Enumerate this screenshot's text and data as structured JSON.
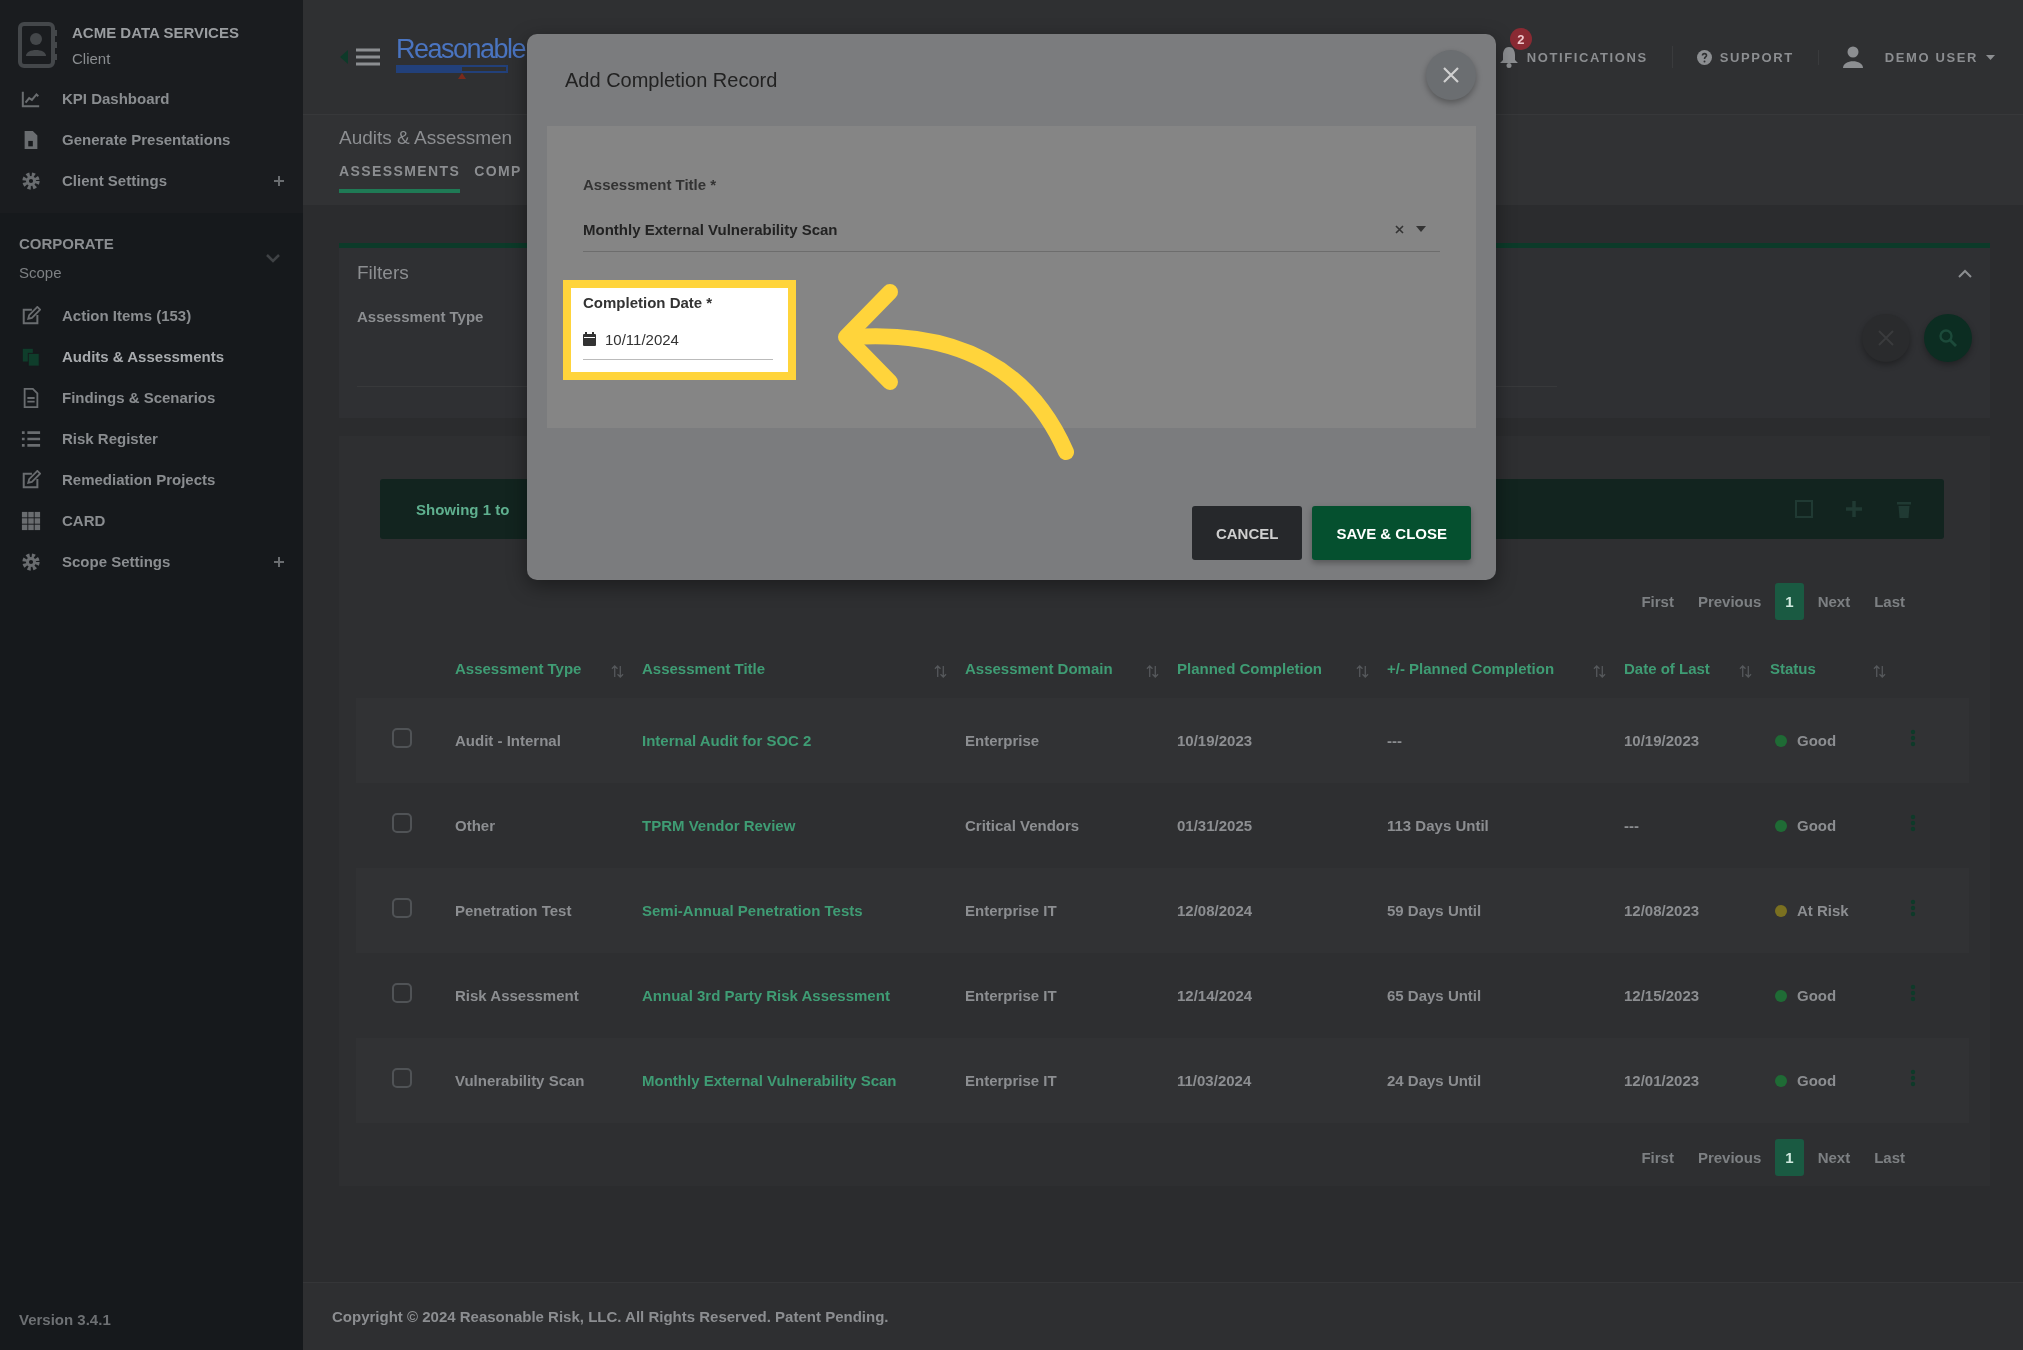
{
  "sidebar": {
    "client": {
      "name": "ACME DATA SERVICES",
      "role": "Client"
    },
    "client_items": [
      {
        "label": "KPI Dashboard",
        "selected": false,
        "expandable": false
      },
      {
        "label": "Generate Presentations",
        "selected": false,
        "expandable": false
      },
      {
        "label": "Client Settings",
        "selected": false,
        "expandable": true
      }
    ],
    "scope": {
      "name": "CORPORATE",
      "role": "Scope",
      "expanded": true
    },
    "scope_items": [
      {
        "label": "Action Items (153)",
        "selected": false,
        "expandable": false
      },
      {
        "label": "Audits & Assessments",
        "selected": true,
        "expandable": false
      },
      {
        "label": "Findings & Scenarios",
        "selected": false,
        "expandable": false
      },
      {
        "label": "Risk Register",
        "selected": false,
        "expandable": false
      },
      {
        "label": "Remediation Projects",
        "selected": false,
        "expandable": false
      },
      {
        "label": "CARD",
        "selected": false,
        "expandable": false
      },
      {
        "label": "Scope Settings",
        "selected": false,
        "expandable": true
      }
    ],
    "version": "Version 3.4.1"
  },
  "header": {
    "logo": "Reasonable",
    "notifications": {
      "label": "NOTIFICATIONS",
      "badge": "2"
    },
    "support": "SUPPORT",
    "user": "DEMO USER"
  },
  "page": {
    "title": "Audits & Assessmen",
    "tabs": [
      {
        "label": "ASSESSMENTS",
        "selected": true
      },
      {
        "label": "COMP",
        "selected": false
      }
    ]
  },
  "filters": {
    "title": "Filters",
    "expanded": true,
    "fields": [
      {
        "label": "Assessment Type"
      }
    ]
  },
  "table": {
    "summary": "Showing 1 to",
    "pagination_top": [
      {
        "label": "First",
        "selected": false
      },
      {
        "label": "Previous",
        "selected": false
      },
      {
        "label": "1",
        "selected": true
      },
      {
        "label": "Next",
        "selected": false
      },
      {
        "label": "Last",
        "selected": false
      }
    ],
    "columns": [
      "Assessment Type",
      "Assessment Title",
      "Assessment Domain",
      "Planned Completion",
      "+/- Planned Completion",
      "Date of Last",
      "Status"
    ],
    "rows": [
      {
        "checked": false,
        "type": "Audit - Internal",
        "title": "Internal Audit for SOC 2",
        "domain": "Enterprise",
        "planned": "10/19/2023",
        "delta": "---",
        "last": "10/19/2023",
        "status": {
          "label": "Good",
          "color": "#1f6b35"
        }
      },
      {
        "checked": false,
        "type": "Other",
        "title": "TPRM Vendor Review",
        "domain": "Critical Vendors",
        "planned": "01/31/2025",
        "delta": "113 Days Until",
        "last": "---",
        "status": {
          "label": "Good",
          "color": "#1f6b35"
        }
      },
      {
        "checked": false,
        "type": "Penetration Test",
        "title": "Semi-Annual Penetration Tests",
        "domain": "Enterprise IT",
        "planned": "12/08/2024",
        "delta": "59 Days Until",
        "last": "12/08/2023",
        "status": {
          "label": "At Risk",
          "color": "#7a7020"
        }
      },
      {
        "checked": false,
        "type": "Risk Assessment",
        "title": "Annual 3rd Party Risk Assessment",
        "domain": "Enterprise IT",
        "planned": "12/14/2024",
        "delta": "65 Days Until",
        "last": "12/15/2023",
        "status": {
          "label": "Good",
          "color": "#1f6b35"
        }
      },
      {
        "checked": false,
        "type": "Vulnerability Scan",
        "title": "Monthly External Vulnerability Scan",
        "domain": "Enterprise IT",
        "planned": "11/03/2024",
        "delta": "24 Days Until",
        "last": "12/01/2023",
        "status": {
          "label": "Good",
          "color": "#1f6b35"
        }
      }
    ],
    "pagination_bottom": [
      {
        "label": "First",
        "selected": false
      },
      {
        "label": "Previous",
        "selected": false
      },
      {
        "label": "1",
        "selected": true
      },
      {
        "label": "Next",
        "selected": false
      },
      {
        "label": "Last",
        "selected": false
      }
    ]
  },
  "footer": {
    "copyright": "Copyright © 2024 Reasonable Risk, LLC. All Rights Reserved. Patent Pending."
  },
  "modal": {
    "title": "Add Completion Record",
    "fields": [
      {
        "kind": "select",
        "label": "Assessment Title *",
        "value": "Monthly External Vulnerability Scan",
        "highlighted": false
      },
      {
        "kind": "date",
        "label": "Completion Date *",
        "value": "10/11/2024",
        "highlighted": true
      }
    ],
    "buttons": [
      {
        "label": "CANCEL",
        "kind": "secondary"
      },
      {
        "label": "SAVE & CLOSE",
        "kind": "primary"
      }
    ]
  }
}
